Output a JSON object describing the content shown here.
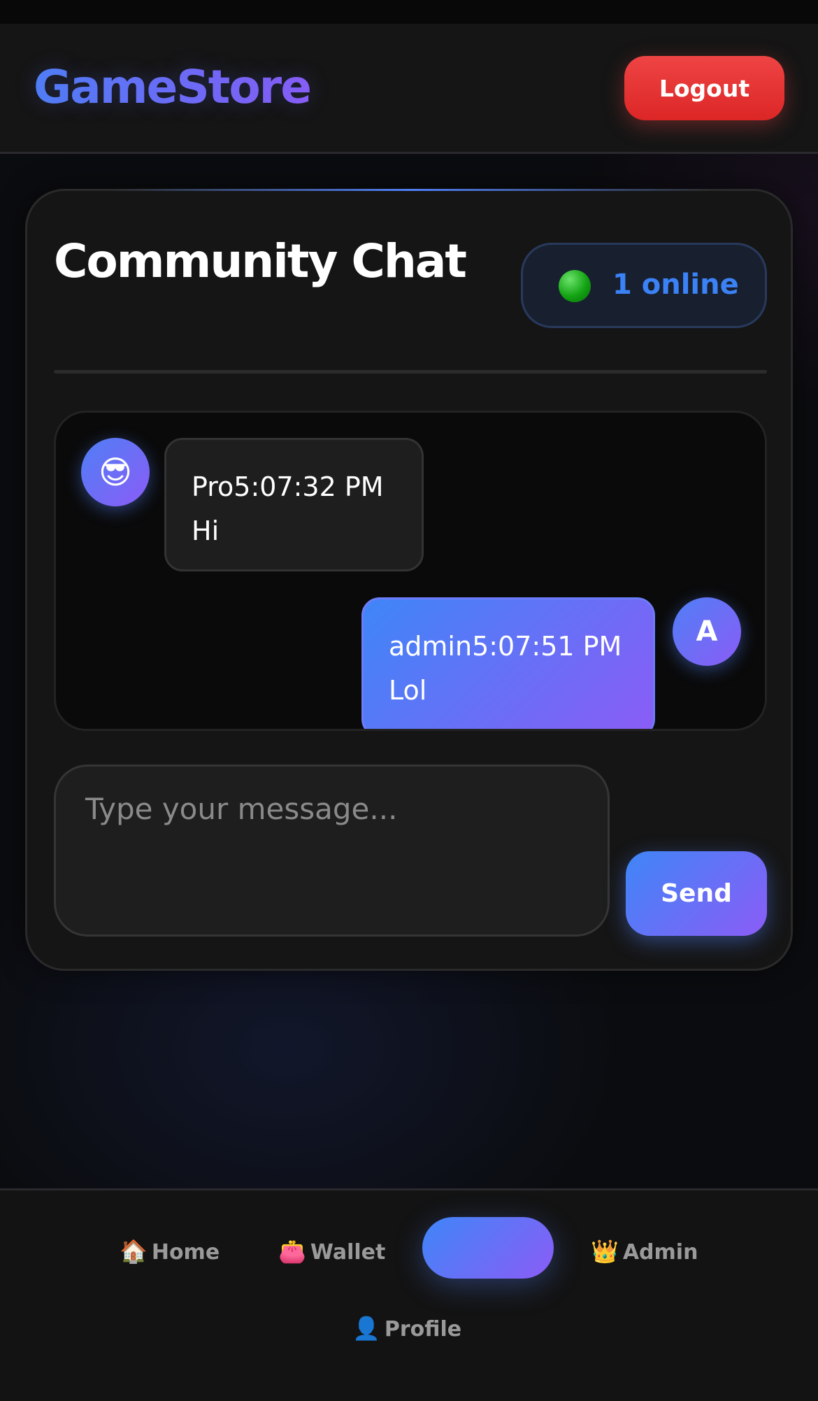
{
  "header": {
    "brand": "GameStore",
    "logout_label": "Logout"
  },
  "chat": {
    "title": "Community Chat",
    "online_count_label": "1 online",
    "messages": [
      {
        "avatar": "😎",
        "header": "Pro5:07:32 PM",
        "text": "Hi",
        "side": "left"
      },
      {
        "avatar": "A",
        "header": "admin5:07:51 PM",
        "text": "Lol",
        "side": "right"
      }
    ],
    "input_placeholder": "Type your message...",
    "send_label": "Send"
  },
  "nav": {
    "items": [
      {
        "icon": "🏠",
        "label": "Home"
      },
      {
        "icon": "👛",
        "label": "Wallet"
      },
      {
        "icon": "",
        "label": ""
      },
      {
        "icon": "👑",
        "label": "Admin"
      },
      {
        "icon": "👤",
        "label": "Profile"
      }
    ]
  },
  "colors": {
    "accent_start": "#4f7ff6",
    "accent_end": "#8b5cf6",
    "logout": "#ef4444",
    "online_text": "#3b82f6",
    "online_dot": "#13a313"
  }
}
